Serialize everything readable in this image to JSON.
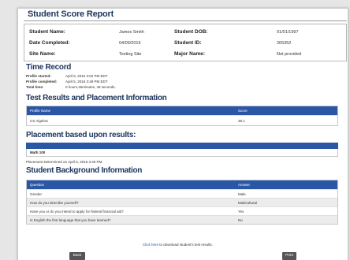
{
  "title": "Student Score Report",
  "info": {
    "student_name_label": "Student Name:",
    "student_name": "James Smith",
    "date_completed_label": "Date Completed:",
    "date_completed": "04/05/2016",
    "site_name_label": "Site Name:",
    "site_name": "Testing Site",
    "dob_label": "Student DOB:",
    "dob": "01/01/1997",
    "student_id_label": "Student ID:",
    "student_id": "265352",
    "major_label": "Major Name:",
    "major": "Not provided"
  },
  "time_record": {
    "heading": "Time Record",
    "rows": [
      {
        "k": "Profile started:",
        "v": "April 5, 2016 3:02 PM EDT"
      },
      {
        "k": "Profile completed:",
        "v": "April 5, 2016 3:49 PM EDT"
      },
      {
        "k": "Total time:",
        "v": "0 hours,46minutes, 48 seconds."
      }
    ]
  },
  "results": {
    "heading": "Test Results and Placement Information",
    "col1": "Profile Name",
    "col2": "Score",
    "rows": [
      {
        "name": "CS Algebra",
        "score": "38.1"
      }
    ]
  },
  "placement": {
    "heading": "Placement based upon results:",
    "value": "Math 100",
    "determined": "Placement Determined on April 5, 2016 3:49 PM."
  },
  "background": {
    "heading": "Student Background Information",
    "col1": "Question",
    "col2": "Answer",
    "rows": [
      {
        "q": "Gender",
        "a": "Male"
      },
      {
        "q": "How do you describe yourself?",
        "a": "Multicultural"
      },
      {
        "q": "Have you or do you intend to apply for federal financial aid?",
        "a": "Yes"
      },
      {
        "q": "Is English the first language that you have learned?",
        "a": "No"
      }
    ]
  },
  "download": {
    "link": "Click here",
    "text": " to download student's test results."
  },
  "buttons": {
    "back": "Back",
    "print": "Print"
  }
}
